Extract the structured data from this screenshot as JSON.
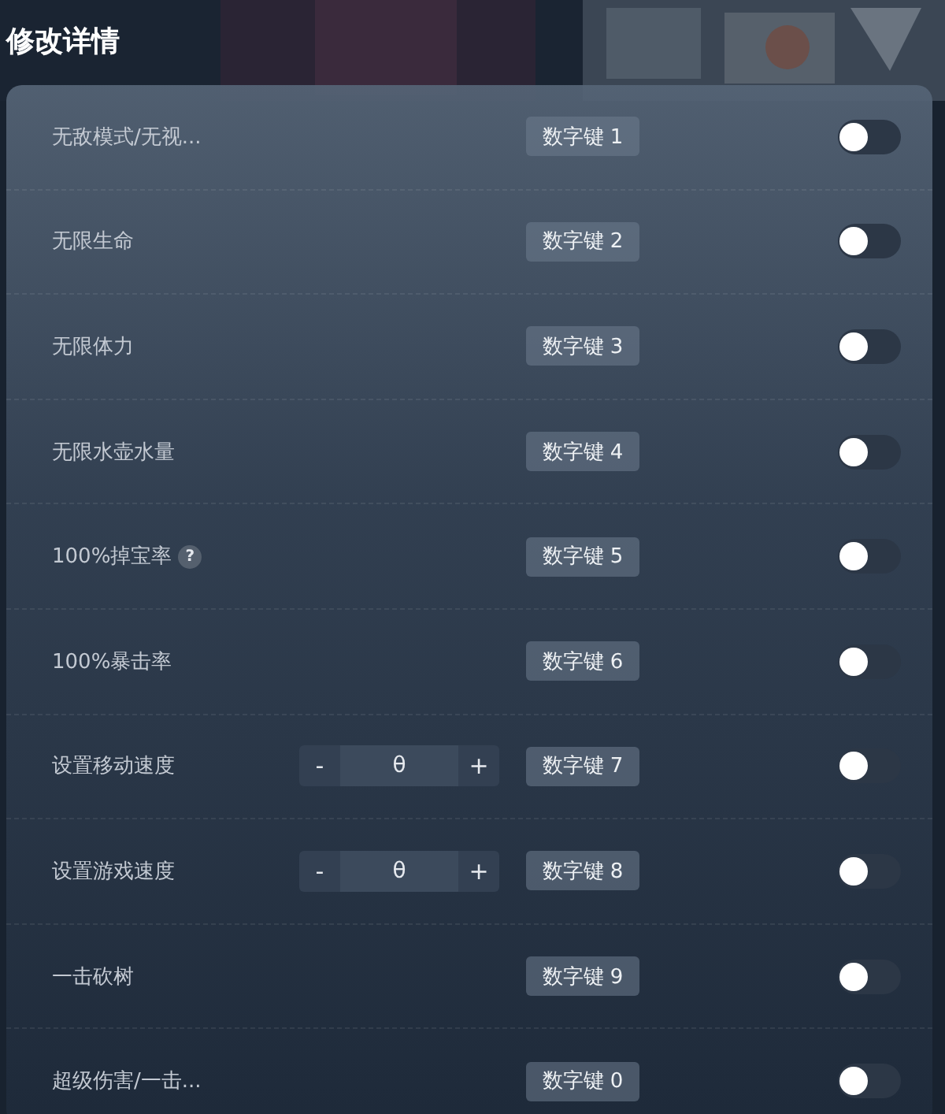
{
  "title": "修改详情",
  "rows": [
    {
      "kind": "toggle",
      "label": "无敌模式/无视...",
      "key": "数字键 1",
      "on": false
    },
    {
      "kind": "toggle",
      "label": "无限生命",
      "key": "数字键 2",
      "on": false
    },
    {
      "kind": "toggle",
      "label": "无限体力",
      "key": "数字键 3",
      "on": false
    },
    {
      "kind": "toggle",
      "label": "无限水壶水量",
      "key": "数字键 4",
      "on": false
    },
    {
      "kind": "toggle",
      "label": "100%掉宝率",
      "help": "?",
      "key": "数字键 5",
      "on": false
    },
    {
      "kind": "toggle",
      "label": "100%暴击率",
      "key": "数字键 6",
      "on": false
    },
    {
      "kind": "stepper",
      "label": "设置移动速度",
      "minus": "-",
      "value": "θ",
      "plus": "+",
      "key": "数字键 7",
      "on": false
    },
    {
      "kind": "stepper",
      "label": "设置游戏速度",
      "minus": "-",
      "value": "θ",
      "plus": "+",
      "key": "数字键 8",
      "on": false
    },
    {
      "kind": "toggle",
      "label": "一击砍树",
      "key": "数字键 9",
      "on": false
    },
    {
      "kind": "toggle",
      "label": "超级伤害/一击...",
      "key": "数字键 0",
      "on": false
    }
  ]
}
